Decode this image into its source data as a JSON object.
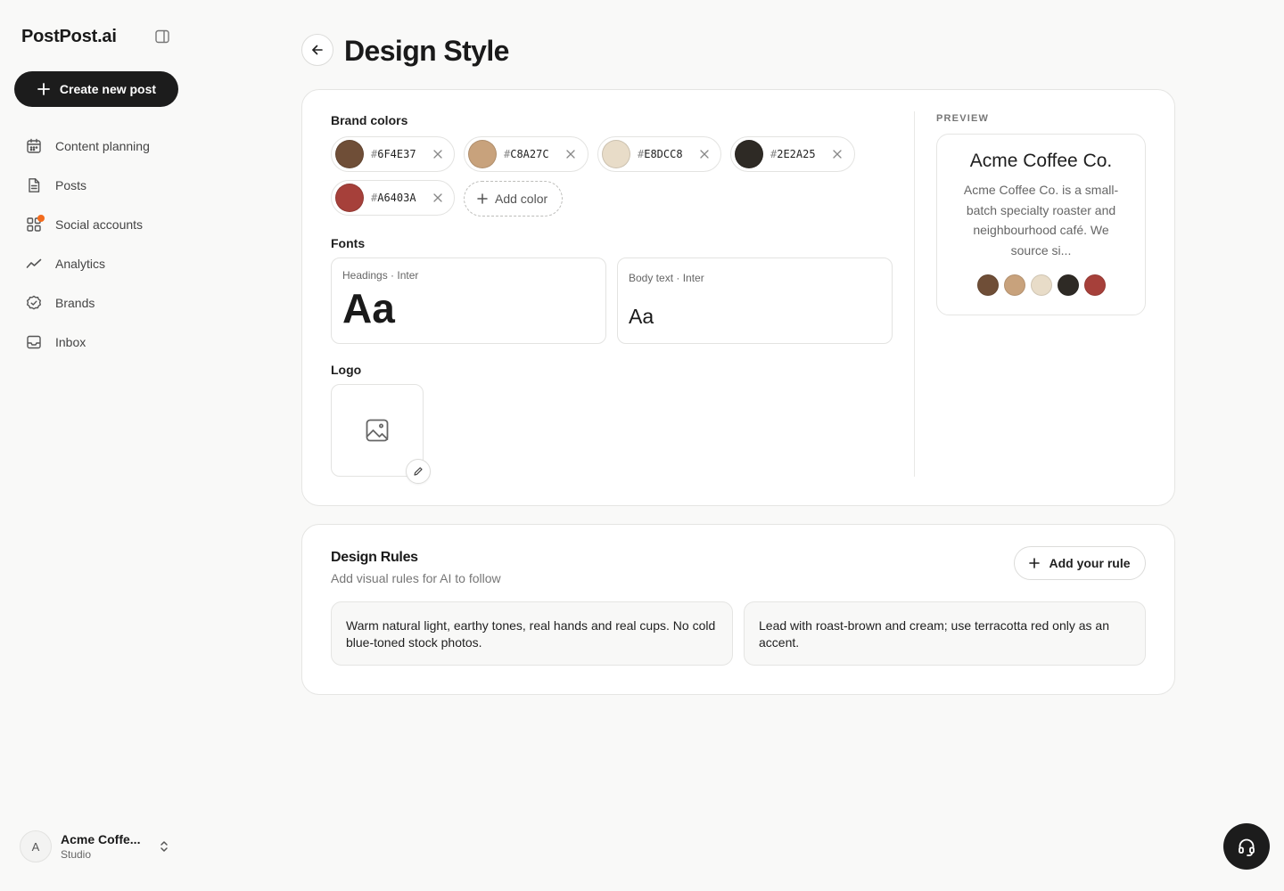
{
  "app": {
    "name": "PostPost.ai"
  },
  "sidebar": {
    "create_label": "Create new post",
    "items": [
      {
        "label": "Content planning",
        "icon": "calendar-icon"
      },
      {
        "label": "Posts",
        "icon": "document-icon"
      },
      {
        "label": "Social accounts",
        "icon": "grid-icon",
        "notification": true
      },
      {
        "label": "Analytics",
        "icon": "trend-line-icon"
      },
      {
        "label": "Brands",
        "icon": "badge-check-icon"
      },
      {
        "label": "Inbox",
        "icon": "inbox-icon"
      }
    ],
    "account": {
      "initial": "A",
      "name": "Acme Coffe...",
      "plan": "Studio"
    }
  },
  "header": {
    "title": "Design Style"
  },
  "design": {
    "brand_colors_label": "Brand colors",
    "colors": [
      {
        "hex": "6F4E37",
        "color": "#6F4E37"
      },
      {
        "hex": "C8A27C",
        "color": "#C8A27C"
      },
      {
        "hex": "E8DCC8",
        "color": "#E8DCC8"
      },
      {
        "hex": "2E2A25",
        "color": "#2E2A25"
      },
      {
        "hex": "A6403A",
        "color": "#A6403A"
      }
    ],
    "hash": "#",
    "add_color_label": "Add color",
    "fonts_label": "Fonts",
    "headings_caption": "Headings · Inter",
    "body_caption": "Body text · Inter",
    "font_sample": "Aa",
    "logo_label": "Logo"
  },
  "preview": {
    "label": "PREVIEW",
    "brand_name": "Acme Coffee Co.",
    "description": "Acme Coffee Co. is a small-batch specialty roaster and neighbourhood café. We source si..."
  },
  "rules": {
    "title": "Design Rules",
    "subtitle": "Add visual rules for AI to follow",
    "add_label": "Add your rule",
    "items": [
      "Warm natural light, earthy tones, real hands and real cups. No cold blue-toned stock photos.",
      "Lead with roast-brown and cream; use terracotta red only as an accent."
    ]
  }
}
